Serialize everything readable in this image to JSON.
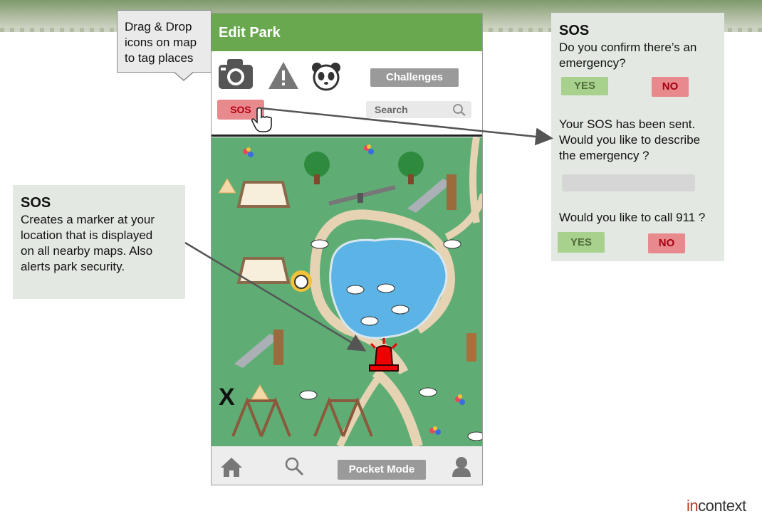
{
  "phone": {
    "title": "Edit Park",
    "challenges_label": "Challenges",
    "sos_label": "SOS",
    "search_placeholder": "Search",
    "pocket_mode_label": "Pocket Mode",
    "map_marker_x": "X"
  },
  "callouts": {
    "drag_drop": [
      "Drag & Drop",
      "icons on map",
      "to tag places"
    ],
    "sos_note": {
      "heading": "SOS",
      "lines": [
        "Creates a marker at your",
        "location that is displayed",
        "on all nearby maps. Also",
        "alerts park security."
      ]
    }
  },
  "sos_panel": {
    "heading": "SOS",
    "confirm_lines": [
      "Do you confirm there’s an",
      "emergency?"
    ],
    "yes_label": "YES",
    "no_label": "NO",
    "sent_lines": [
      "Your SOS has been sent.",
      "Would you like to describe",
      "the emergency ?"
    ],
    "call_text": "Would you like to call 911 ?",
    "yes2_label": "YES",
    "no2_label": "NO"
  },
  "brand": {
    "prefix": "in",
    "suffix": "context"
  },
  "colors": {
    "header_green": "#6aa84f",
    "sos_red": "#e8898d",
    "yes_green": "#a9d18e",
    "map_green": "#5fad75",
    "panel_bg": "#e3e9e2"
  }
}
